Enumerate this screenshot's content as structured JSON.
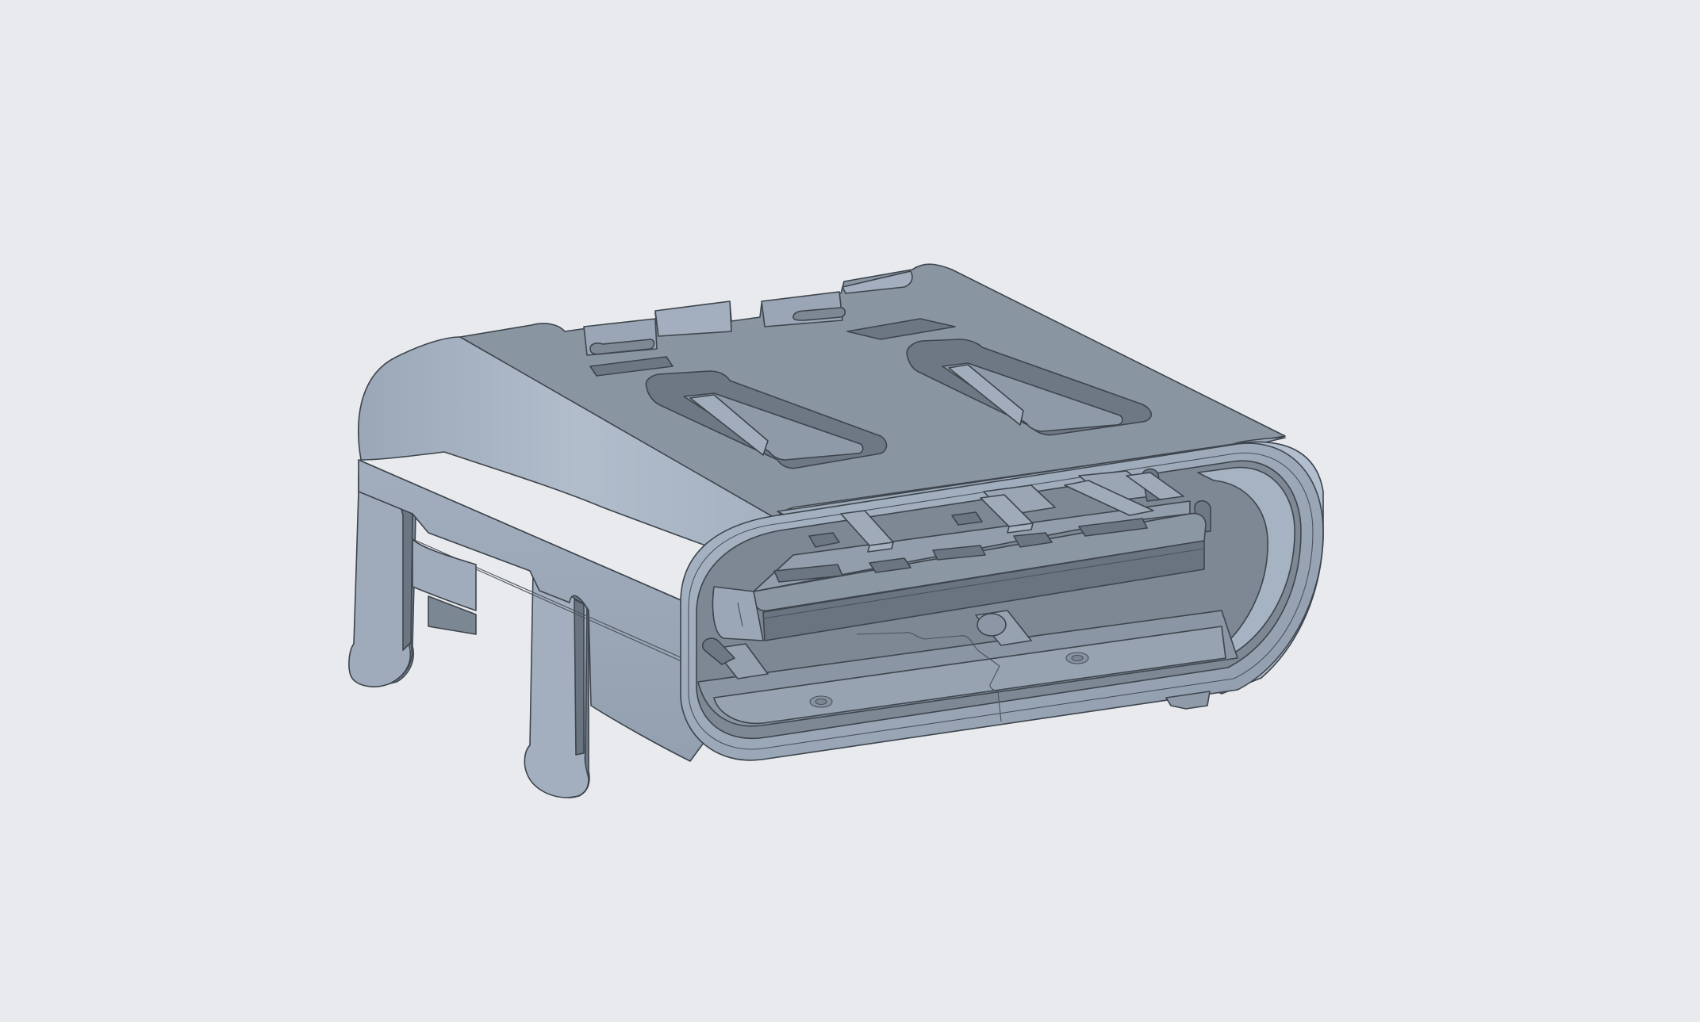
{
  "viewer": {
    "background_color": "#e8eaed"
  },
  "model": {
    "icon": "usb-c-receptacle-3d-model",
    "colors": {
      "top_face": "#8b96a3",
      "front_face": "#9ba8b8",
      "side_face": "#a7b4c5",
      "highlight": "#b4c0ce",
      "dark_face": "#6e7884",
      "cavity": "#7d8894",
      "edge": "#3d444c"
    }
  }
}
